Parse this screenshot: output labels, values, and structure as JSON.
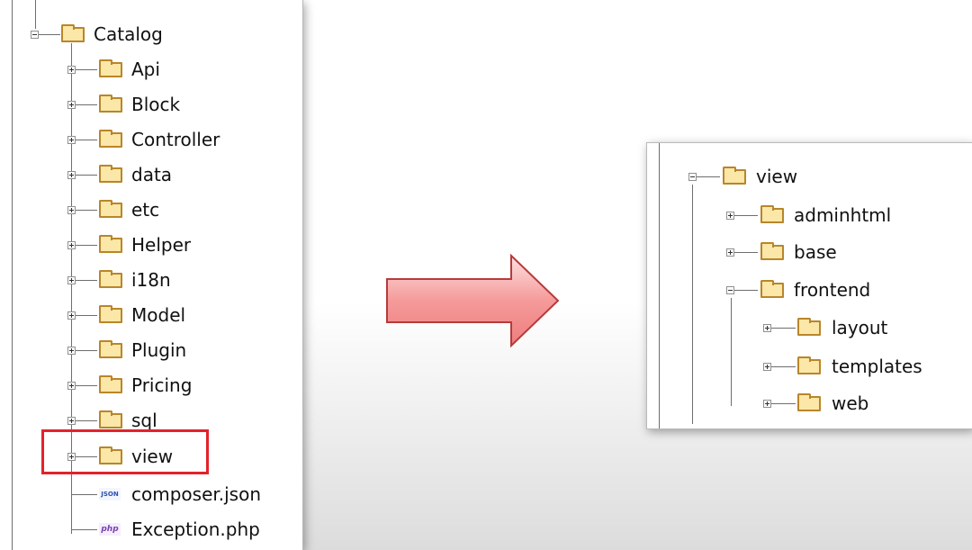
{
  "left_tree": {
    "root": "Catalog",
    "folders": [
      "Api",
      "Block",
      "Controller",
      "data",
      "etc",
      "Helper",
      "i18n",
      "Model",
      "Plugin",
      "Pricing",
      "sql",
      "view"
    ],
    "files": [
      {
        "icon": "JSON",
        "name": "composer.json"
      },
      {
        "icon": "php",
        "name": "Exception.php"
      }
    ]
  },
  "right_tree": {
    "root": "view",
    "children": [
      {
        "label": "adminhtml",
        "state": "collapsed"
      },
      {
        "label": "base",
        "state": "collapsed"
      },
      {
        "label": "frontend",
        "state": "expanded",
        "children": [
          "layout",
          "templates",
          "web"
        ]
      }
    ]
  },
  "highlight_color": "#e3222a",
  "arrow_color": "#f08080"
}
